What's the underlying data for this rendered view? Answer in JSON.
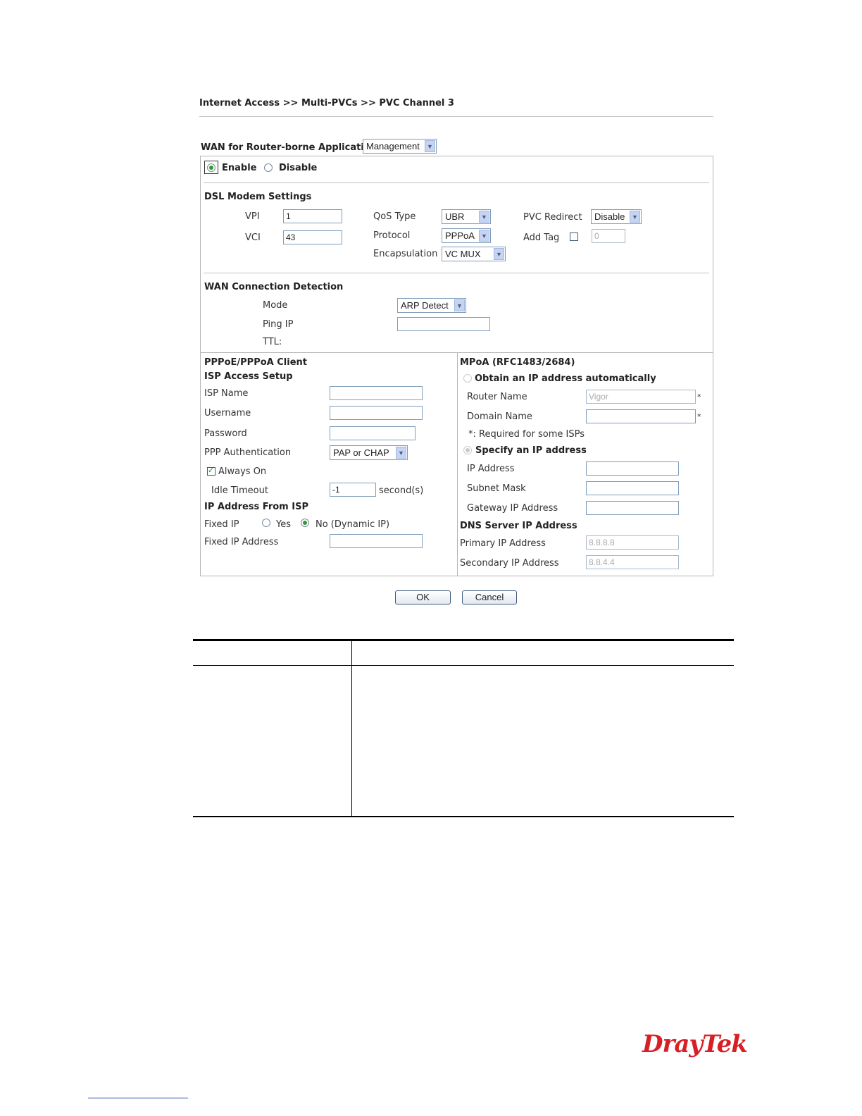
{
  "breadcrumb": "Internet Access >> Multi-PVCs >> PVC Channel 3",
  "wan_app": {
    "label": "WAN for Router-borne Application:",
    "value": "Management"
  },
  "enable": {
    "enable_label": "Enable",
    "disable_label": "Disable",
    "selected": "Enable"
  },
  "dsl": {
    "title": "DSL Modem Settings",
    "vpi_label": "VPI",
    "vpi_value": "1",
    "vci_label": "VCI",
    "vci_value": "43",
    "qos_label": "QoS Type",
    "qos_value": "UBR",
    "protocol_label": "Protocol",
    "protocol_value": "PPPoA",
    "encap_label": "Encapsulation",
    "encap_value": "VC MUX",
    "pvc_redirect_label": "PVC Redirect",
    "pvc_redirect_value": "Disable",
    "add_tag_label": "Add Tag",
    "add_tag_checked": false,
    "add_tag_value": "0"
  },
  "detection": {
    "title": "WAN Connection Detection",
    "mode_label": "Mode",
    "mode_value": "ARP Detect",
    "ping_ip_label": "Ping IP",
    "ping_ip_value": "",
    "ttl_label": "TTL:"
  },
  "pppoe": {
    "title": "PPPoE/PPPoA Client",
    "isp_access": "ISP Access Setup",
    "isp_name_label": "ISP Name",
    "isp_name_value": "",
    "username_label": "Username",
    "username_value": "",
    "password_label": "Password",
    "password_value": "",
    "ppp_auth_label": "PPP Authentication",
    "ppp_auth_value": "PAP or CHAP",
    "always_on_label": "Always On",
    "always_on_checked": true,
    "idle_timeout_label": "Idle Timeout",
    "idle_timeout_value": "-1",
    "idle_timeout_unit": "second(s)",
    "ip_from_isp": "IP Address From ISP",
    "fixed_ip_label": "Fixed IP",
    "fixed_yes": "Yes",
    "fixed_no": "No (Dynamic IP)",
    "fixed_selected": "No",
    "fixed_ip_addr_label": "Fixed IP Address",
    "fixed_ip_addr_value": ""
  },
  "mpoa": {
    "title": "MPoA (RFC1483/2684)",
    "obtain_label": "Obtain an IP address automatically",
    "router_name_label": "Router Name",
    "router_name_value": "Vigor",
    "router_name_mark": "*",
    "domain_name_label": "Domain Name",
    "domain_name_value": "",
    "domain_name_mark": "*",
    "required_note": "*: Required for some ISPs",
    "specify_label": "Specify an IP address",
    "ip_label": "IP Address",
    "ip_value": "",
    "subnet_label": "Subnet Mask",
    "subnet_value": "",
    "gateway_label": "Gateway IP Address",
    "gateway_value": "",
    "dns_title": "DNS Server IP Address",
    "primary_label": "Primary IP Address",
    "primary_value": "8.8.8.8",
    "secondary_label": "Secondary IP Address",
    "secondary_value": "8.8.4.4"
  },
  "buttons": {
    "ok": "OK",
    "cancel": "Cancel"
  },
  "logo": {
    "text": "DrayTek",
    "color": "#d81f26"
  }
}
